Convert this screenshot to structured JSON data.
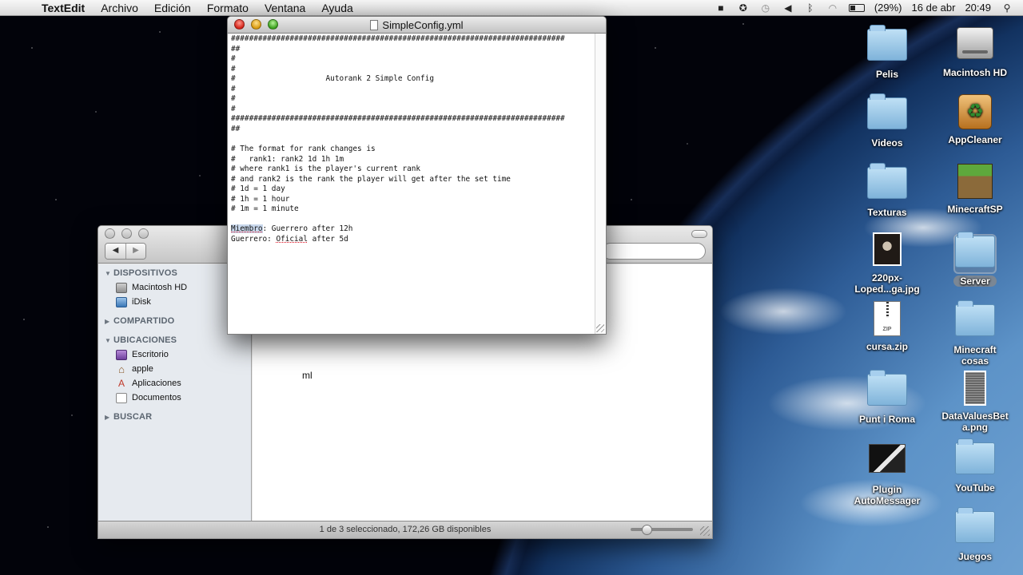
{
  "menubar": {
    "app_name": "TextEdit",
    "menus": [
      "Archivo",
      "Edición",
      "Formato",
      "Ventana",
      "Ayuda"
    ],
    "battery": "(29%)",
    "date": "16 de abr",
    "time": "20:49"
  },
  "textedit": {
    "title": "SimpleConfig.yml",
    "lines": [
      "##########################################################################",
      "##",
      "#",
      "#",
      "#                    Autorank 2 Simple Config",
      "#",
      "#",
      "#",
      "##########################################################################",
      "##",
      "",
      "# The format for rank changes is",
      "#   rank1: rank2 1d 1h 1m",
      "# where rank1 is the player's current rank",
      "# and rank2 is the rank the player will get after the set time",
      "# 1d = 1 day",
      "# 1h = 1 hour",
      "# 1m = 1 minute",
      ""
    ],
    "rule1_rank": "Miembro",
    "rule1_rest": ": Guerrero after 12h",
    "rule2_rank": "Guerrero: ",
    "rule2_target": "Oficial",
    "rule2_rest": " after 5d"
  },
  "finder": {
    "sections": {
      "devices": "DISPOSITIVOS",
      "shared": "COMPARTIDO",
      "places": "UBICACIONES",
      "search": "BUSCAR"
    },
    "devices": [
      "Macintosh HD",
      "iDisk"
    ],
    "places": [
      "Escritorio",
      "apple",
      "Aplicaciones",
      "Documentos"
    ],
    "content_fragment": "ml",
    "status": "1 de 3 seleccionado, 172,26 GB disponibles"
  },
  "desktop_icons": {
    "pelis": "Pelis",
    "macintosh_hd": "Macintosh HD",
    "videos": "Videos",
    "appcleaner": "AppCleaner",
    "texturas": "Texturas",
    "minecraftsp": "MinecraftSP",
    "photo_line1": "220px-",
    "photo_line2": "Loped...ga.jpg",
    "server": "Server",
    "zip": "cursa.zip",
    "zip_tag": "ZIP",
    "minecraft_cosas_1": "Minecraft",
    "minecraft_cosas_2": "cosas",
    "punt_roma": "Punt i Roma",
    "datavalues_1": "DataValuesBet",
    "datavalues_2": "a.png",
    "plugin_1": "Plugin",
    "plugin_2": "AutoMessager",
    "youtube": "YouTube",
    "juegos": "Juegos"
  }
}
